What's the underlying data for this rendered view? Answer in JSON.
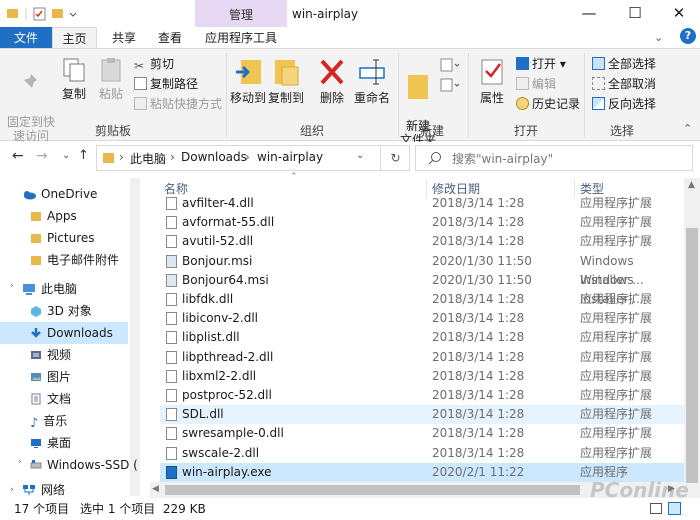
{
  "window": {
    "title": "win-airplay",
    "context_tab": "管理"
  },
  "tabs": [
    {
      "label": "文件"
    },
    {
      "label": "主页"
    },
    {
      "label": "共享"
    },
    {
      "label": "查看"
    },
    {
      "label": "应用程序工具"
    }
  ],
  "ribbon": {
    "clipboard": {
      "pin": "固定到快\n速访问",
      "copy": "复制",
      "paste": "粘贴",
      "cut": "剪切",
      "copy_path": "复制路径",
      "paste_shortcut": "粘贴快捷方式",
      "label": "剪贴板"
    },
    "organize": {
      "move_to": "移动到",
      "copy_to": "复制到",
      "delete": "删除",
      "rename": "重命名",
      "label": "组织"
    },
    "new": {
      "new_folder": "新建\n文件夹",
      "label": "新建"
    },
    "open": {
      "properties": "属性",
      "open": "打开",
      "edit": "编辑",
      "history": "历史记录",
      "label": "打开"
    },
    "select": {
      "select_all": "全部选择",
      "select_none": "全部取消",
      "invert": "反向选择",
      "label": "选择"
    }
  },
  "address": {
    "path": [
      "此电脑",
      "Downloads",
      "win-airplay"
    ],
    "search_placeholder": "搜索\"win-airplay\""
  },
  "nav": [
    {
      "label": "OneDrive",
      "type": "cloud"
    },
    {
      "label": "Apps",
      "type": "folder"
    },
    {
      "label": "Pictures",
      "type": "folder"
    },
    {
      "label": "电子邮件附件",
      "type": "folder"
    },
    {
      "label": "此电脑",
      "type": "pc"
    },
    {
      "label": "3D 对象",
      "type": "cube"
    },
    {
      "label": "Downloads",
      "type": "download"
    },
    {
      "label": "视频",
      "type": "video"
    },
    {
      "label": "图片",
      "type": "picture"
    },
    {
      "label": "文档",
      "type": "doc"
    },
    {
      "label": "音乐",
      "type": "music"
    },
    {
      "label": "桌面",
      "type": "desktop"
    },
    {
      "label": "Windows-SSD (",
      "type": "drive"
    },
    {
      "label": "网络",
      "type": "network"
    }
  ],
  "columns": {
    "name": "名称",
    "date": "修改日期",
    "type": "类型"
  },
  "files": [
    {
      "name": "avfilter-4.dll",
      "date": "2018/3/14 1:28",
      "type": "应用程序扩展"
    },
    {
      "name": "avformat-55.dll",
      "date": "2018/3/14 1:28",
      "type": "应用程序扩展"
    },
    {
      "name": "avutil-52.dll",
      "date": "2018/3/14 1:28",
      "type": "应用程序扩展"
    },
    {
      "name": "Bonjour.msi",
      "date": "2020/1/30 11:50",
      "type": "Windows Installer ..."
    },
    {
      "name": "Bonjour64.msi",
      "date": "2020/1/30 11:50",
      "type": "Windows Installer ..."
    },
    {
      "name": "libfdk.dll",
      "date": "2018/3/14 1:28",
      "type": "应用程序扩展"
    },
    {
      "name": "libiconv-2.dll",
      "date": "2018/3/14 1:28",
      "type": "应用程序扩展"
    },
    {
      "name": "libplist.dll",
      "date": "2018/3/14 1:28",
      "type": "应用程序扩展"
    },
    {
      "name": "libpthread-2.dll",
      "date": "2018/3/14 1:28",
      "type": "应用程序扩展"
    },
    {
      "name": "libxml2-2.dll",
      "date": "2018/3/14 1:28",
      "type": "应用程序扩展"
    },
    {
      "name": "postproc-52.dll",
      "date": "2018/3/14 1:28",
      "type": "应用程序扩展"
    },
    {
      "name": "SDL.dll",
      "date": "2018/3/14 1:28",
      "type": "应用程序扩展"
    },
    {
      "name": "swresample-0.dll",
      "date": "2018/3/14 1:28",
      "type": "应用程序扩展"
    },
    {
      "name": "swscale-2.dll",
      "date": "2018/3/14 1:28",
      "type": "应用程序扩展"
    },
    {
      "name": "win-airplay.exe",
      "date": "2020/2/1 11:22",
      "type": "应用程序"
    }
  ],
  "status": {
    "count": "17 个项目",
    "selection": "选中 1 个项目  229 KB"
  },
  "watermark": "PConline",
  "colors": {
    "accent": "#1f6fc5",
    "selection": "#cce8ff",
    "context_tab": "#e6d7f3"
  }
}
